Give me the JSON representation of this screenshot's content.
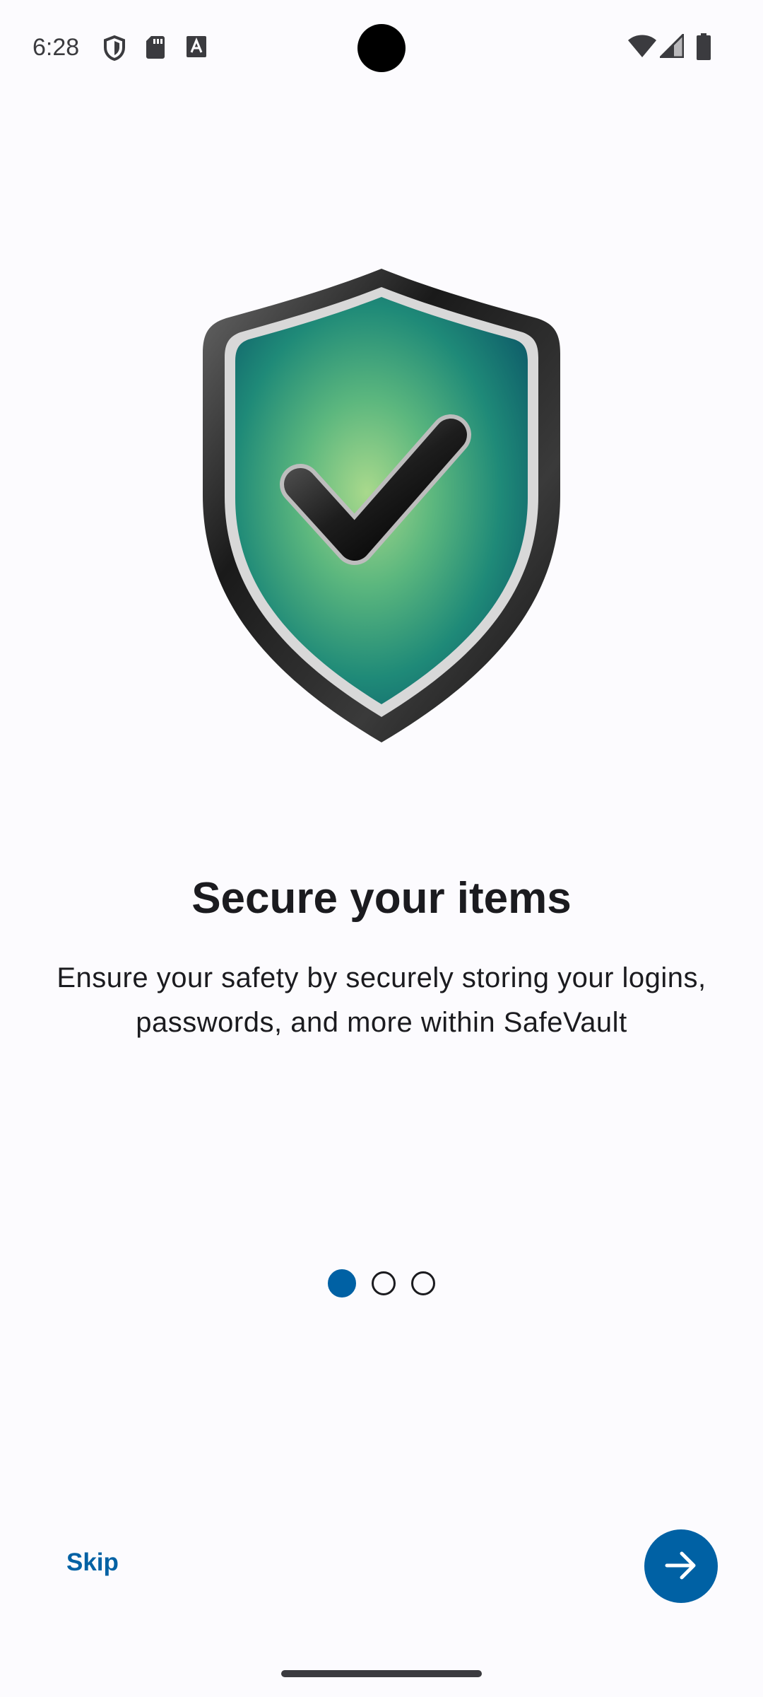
{
  "status_bar": {
    "time": "6:28",
    "left_icons": [
      "shield-icon",
      "sd-card-icon",
      "text-a-icon"
    ],
    "right_icons": [
      "wifi-icon",
      "cellular-signal-icon",
      "battery-icon"
    ]
  },
  "onboarding": {
    "hero_icon": "shield-check-icon",
    "title": "Secure your items",
    "description": "Ensure your safety by securely storing your logins, passwords, and more within SafeVault",
    "page_indicator": {
      "total": 3,
      "current": 1
    },
    "skip_label": "Skip",
    "next_icon": "arrow-right-icon"
  },
  "colors": {
    "accent": "#0061a4",
    "background": "#fcfbfe",
    "text": "#1b1b1f"
  }
}
